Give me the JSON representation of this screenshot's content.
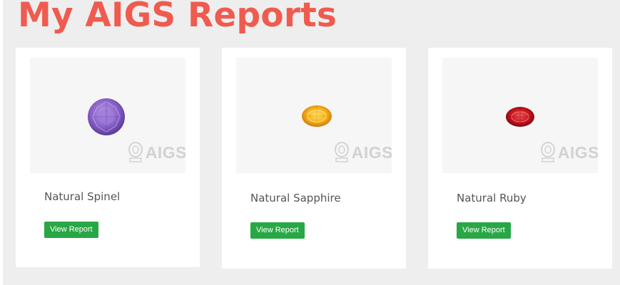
{
  "page": {
    "title": "My AIGS Reports"
  },
  "watermark_text": "AIGS",
  "colors": {
    "title": "#ef5b4f",
    "button": "#28a745",
    "background": "#eeeeee"
  },
  "reports": [
    {
      "name": "Natural Spinel",
      "button_label": "View Report",
      "gem_icon": "purple-round-gem"
    },
    {
      "name": "Natural Sapphire",
      "button_label": "View Report",
      "gem_icon": "yellow-oval-gem"
    },
    {
      "name": "Natural Ruby",
      "button_label": "View Report",
      "gem_icon": "red-oval-gem"
    }
  ]
}
